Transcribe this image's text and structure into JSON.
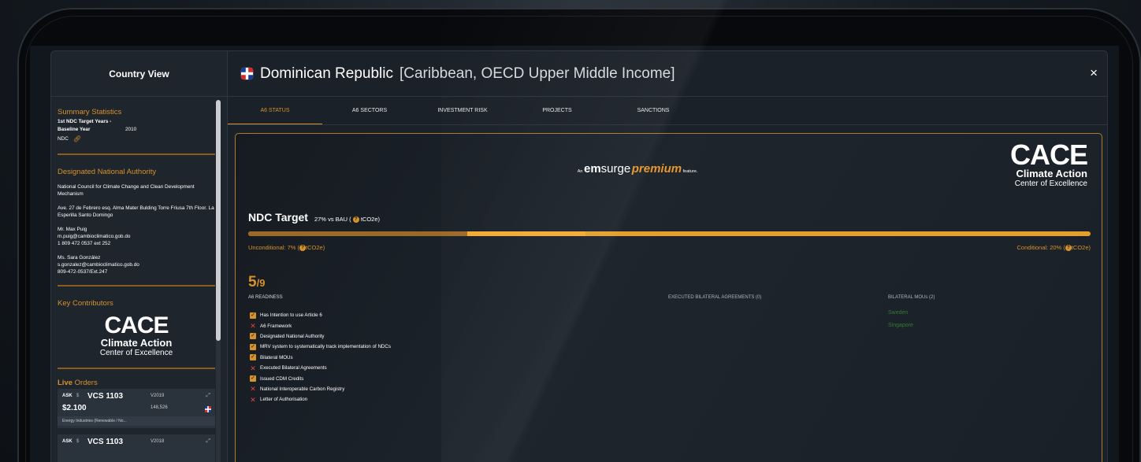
{
  "sidebar": {
    "title": "Country View",
    "summary": {
      "heading": "Summary Statistics",
      "ndc_years_label": "1st NDC Target Years -",
      "baseline_label": "Baseline Year",
      "baseline_value": "2010",
      "ndc_label": "NDC"
    },
    "dna": {
      "heading": "Designated National Authority",
      "org": "National Council for Climate Change and Clean Development Mechanism",
      "address": "Ave. 27 de Febrero esq. Alma Mater Bulding Torre Friusa 7th Floor. La Esperilla Santo Domingo",
      "contact1_name": "Mr. Max Puig",
      "contact1_email": "m.puig@cambioclimatico.gob.do",
      "contact1_phone": "1 809 472 0537 ext 252",
      "contact2_name": "Ms. Sara González",
      "contact2_email": "s.gonzalez@cambioclimatico.gob.do",
      "contact2_phone": "809-472-0537/Ext.247"
    },
    "contributors": {
      "heading": "Key Contributors",
      "logo_big": "CACE",
      "logo_mid": "Climate Action",
      "logo_small": "Center of Excellence"
    },
    "orders": {
      "heading_live": "Live",
      "heading_rest": " Orders",
      "items": [
        {
          "side": "ASK",
          "currency": "$",
          "name": "VCS 1103",
          "vintage": "V2019",
          "price": "$2.100",
          "qty": "148,526",
          "category": "Energy Industries (Renewable / No..."
        },
        {
          "side": "ASK",
          "currency": "$",
          "name": "VCS 1103",
          "vintage": "V2018",
          "price": "",
          "qty": "",
          "category": ""
        }
      ]
    }
  },
  "header": {
    "country": "Dominican Republic",
    "region": "[Caribbean, OECD Upper Middle Income]",
    "close": "×"
  },
  "tabs": [
    "A6 STATUS",
    "A6 SECTORS",
    "INVESTMENT RISK",
    "PROJECTS",
    "SANCTIONS"
  ],
  "feature": {
    "prefix": "An",
    "brand_em": "em",
    "brand_surge": "surge",
    "brand_premium": "premium",
    "suffix": "feature."
  },
  "card_logo": {
    "big": "CACE",
    "mid": "Climate Action",
    "small": "Center of Excellence"
  },
  "ndc": {
    "title": "NDC Target",
    "subtitle_a": "27% vs BAU  (",
    "subtitle_b": "tCO2e)",
    "unconditional": "Unconditional: 7% (",
    "unconditional_unit": "tCO2e)",
    "conditional": "Conditional: 20% (",
    "conditional_unit": "tCO2e)",
    "unconditional_fraction": 0.07,
    "conditional_fraction": 0.2
  },
  "readiness": {
    "score": "5",
    "total": "/9",
    "label": "A6 READINESS",
    "items": [
      {
        "label": "Has Intention to use Article 6",
        "met": true
      },
      {
        "label": "A6 Framework",
        "met": false
      },
      {
        "label": "Designated National Authority",
        "met": true
      },
      {
        "label": "MRV system to systematically track implementation of NDCs",
        "met": true
      },
      {
        "label": "Bilateral MOUs",
        "met": true
      },
      {
        "label": "Executed Bilateral Agreements",
        "met": false
      },
      {
        "label": "Issued CDM Credits",
        "met": true
      },
      {
        "label": "National Interoperable Carbon Registry",
        "met": false
      },
      {
        "label": "Letter of Authorisation",
        "met": false
      }
    ]
  },
  "agreements": {
    "heading": "EXECUTED BILATERAL AGREEMENTS (0)"
  },
  "mous": {
    "heading": "BILATERAL MOUs (2)",
    "items": [
      "Sweden",
      "Singapore"
    ]
  },
  "colors": {
    "accent": "#d8922a",
    "bg": "#1b2129",
    "check_fail": "#e0443c",
    "mou_text": "#2f7d2f"
  }
}
